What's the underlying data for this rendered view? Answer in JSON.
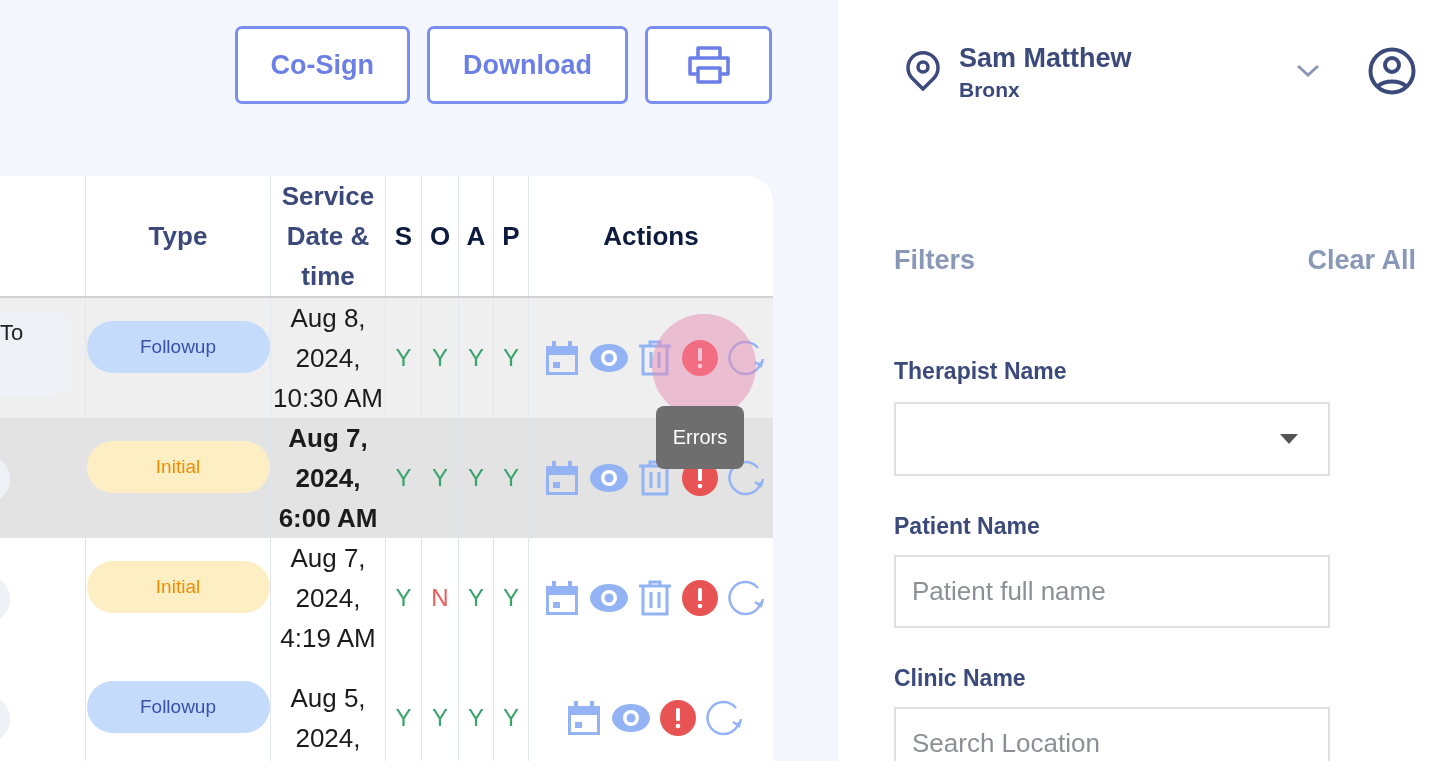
{
  "header_buttons": [
    {
      "kind": "text",
      "label": "Co-Sign"
    },
    {
      "kind": "text",
      "label": "Download"
    },
    {
      "kind": "print"
    }
  ],
  "table": {
    "columns": [
      {
        "label": "Type",
        "sortable": true
      },
      {
        "label": "Service Date & time",
        "sortable": true
      },
      {
        "label": "S",
        "sortable": false
      },
      {
        "label": "O",
        "sortable": false
      },
      {
        "label": "A",
        "sortable": false
      },
      {
        "label": "P",
        "sortable": false
      },
      {
        "label": "Actions",
        "sortable": false
      }
    ],
    "rows": [
      {
        "hovered": true,
        "selected": false,
        "column_1": {
          "kind": "chip",
          "text": "To"
        },
        "type": {
          "kind": "followup",
          "label": "Followup"
        },
        "date": "Aug 8, 2024, 10:30 AM",
        "soap": [
          "Y",
          "Y",
          "Y",
          "Y"
        ],
        "actions": [
          {
            "kind": "calendar"
          },
          {
            "kind": "view"
          },
          {
            "kind": "delete"
          },
          {
            "kind": "error",
            "hovered": true,
            "tooltip": "Errors"
          },
          {
            "kind": "refresh"
          }
        ]
      },
      {
        "hovered": false,
        "selected": true,
        "column_1": {
          "kind": "chip"
        },
        "type": {
          "kind": "initial",
          "label": "Initial"
        },
        "date": "Aug 7, 2024, 6:00 AM",
        "soap": [
          "Y",
          "Y",
          "Y",
          "Y"
        ],
        "actions": [
          {
            "kind": "calendar"
          },
          {
            "kind": "view"
          },
          {
            "kind": "delete"
          },
          {
            "kind": "error",
            "hovered": false
          },
          {
            "kind": "refresh"
          }
        ]
      },
      {
        "hovered": false,
        "selected": false,
        "column_1": {
          "kind": "chip"
        },
        "type": {
          "kind": "initial",
          "label": "Initial"
        },
        "date": "Aug 7, 2024, 4:19 AM",
        "soap": [
          "Y",
          "N",
          "Y",
          "Y"
        ],
        "actions": [
          {
            "kind": "calendar"
          },
          {
            "kind": "view"
          },
          {
            "kind": "delete"
          },
          {
            "kind": "error",
            "hovered": false
          },
          {
            "kind": "refresh"
          }
        ]
      },
      {
        "hovered": false,
        "selected": false,
        "column_1": {
          "kind": "chip"
        },
        "type": {
          "kind": "followup",
          "label": "Followup"
        },
        "date": "Aug 5, 2024,",
        "soap": [
          "Y",
          "Y",
          "Y",
          "Y"
        ],
        "actions": [
          {
            "kind": "calendar"
          },
          {
            "kind": "view"
          },
          {
            "kind": "error",
            "hovered": false
          },
          {
            "kind": "refresh"
          }
        ]
      }
    ]
  },
  "user": {
    "name": "Sam Matthew",
    "location": "Bronx"
  },
  "filters": {
    "title": "Filters",
    "clear_label": "Clear All",
    "fields": [
      {
        "kind": "select",
        "label": "Therapist Name"
      },
      {
        "kind": "text",
        "label": "Patient Name",
        "placeholder": "Patient full name"
      },
      {
        "kind": "text",
        "label": "Clinic Name",
        "placeholder": "Search Location"
      }
    ]
  }
}
